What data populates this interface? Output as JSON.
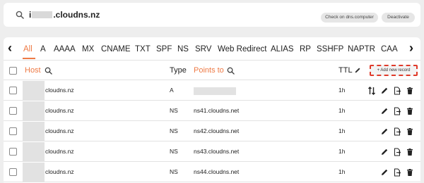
{
  "domain": {
    "prefix": "i",
    "suffix": ".cloudns.nz",
    "check_button": "Check on dns.computer",
    "deactivate_button": "Deactivate"
  },
  "tabs": [
    "All",
    "A",
    "AAAA",
    "MX",
    "CNAME",
    "TXT",
    "SPF",
    "NS",
    "SRV",
    "Web Redirect",
    "ALIAS",
    "RP",
    "SSHFP",
    "NAPTR",
    "CAA"
  ],
  "active_tab": "All",
  "table": {
    "headers": {
      "host": "Host",
      "type": "Type",
      "points_to": "Points to",
      "ttl": "TTL"
    },
    "add_button": "+ Add new record",
    "rows": [
      {
        "host": "cloudns.nz",
        "type": "A",
        "points_to": "",
        "ttl": "1h"
      },
      {
        "host": "cloudns.nz",
        "type": "NS",
        "points_to": "ns41.cloudns.net",
        "ttl": "1h"
      },
      {
        "host": "cloudns.nz",
        "type": "NS",
        "points_to": "ns42.cloudns.net",
        "ttl": "1h"
      },
      {
        "host": "cloudns.nz",
        "type": "NS",
        "points_to": "ns43.cloudns.net",
        "ttl": "1h"
      },
      {
        "host": "cloudns.nz",
        "type": "NS",
        "points_to": "ns44.cloudns.net",
        "ttl": "1h"
      }
    ]
  },
  "colors": {
    "accent": "#ee7a45",
    "highlight": "#e03a2a"
  }
}
